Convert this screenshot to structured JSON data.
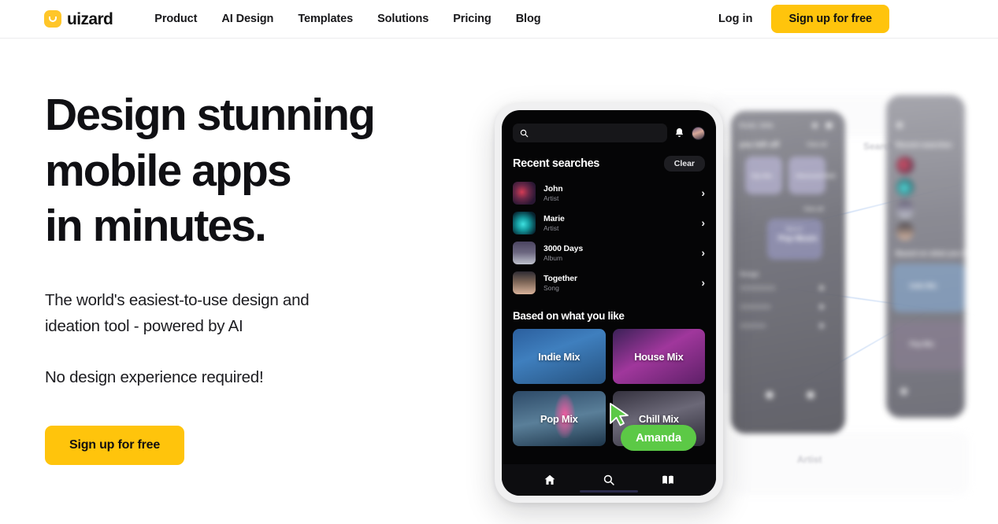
{
  "brand": {
    "name": "uizard",
    "logo_color": "#FFC629"
  },
  "nav": {
    "links": [
      {
        "label": "Product"
      },
      {
        "label": "AI Design"
      },
      {
        "label": "Templates"
      },
      {
        "label": "Solutions"
      },
      {
        "label": "Pricing"
      },
      {
        "label": "Blog"
      }
    ],
    "login_label": "Log in",
    "signup_label": "Sign up for free",
    "accent_color": "#FFC40C"
  },
  "hero": {
    "headline_line1": "Design stunning",
    "headline_line2": "mobile apps",
    "headline_line3": "in minutes.",
    "subtitle_line1": "The world's easiest-to-use design and",
    "subtitle_line2": "ideation tool - powered by AI",
    "note": "No design experience required!",
    "cta_label": "Sign up for free"
  },
  "phone": {
    "search": {
      "value": "",
      "placeholder": ""
    },
    "icons": {
      "search": "search-icon",
      "bell": "bell-icon",
      "avatar": "avatar"
    },
    "recent": {
      "title": "Recent searches",
      "clear_label": "Clear",
      "items": [
        {
          "name": "John",
          "type": "Artist"
        },
        {
          "name": "Marie",
          "type": "Artist"
        },
        {
          "name": "3000 Days",
          "type": "Album"
        },
        {
          "name": "Together",
          "type": "Song"
        }
      ]
    },
    "recommendations": {
      "title": "Based on what you like",
      "cards": [
        {
          "label": "Indie Mix"
        },
        {
          "label": "House Mix"
        },
        {
          "label": "Pop Mix"
        },
        {
          "label": "Chill Mix"
        }
      ]
    },
    "tabbar": [
      {
        "icon": "home-icon"
      },
      {
        "icon": "search-icon"
      },
      {
        "icon": "book-icon"
      }
    ]
  },
  "collaborator": {
    "name": "Amanda",
    "cursor_color": "#5CC946"
  },
  "background_screens": {
    "left": {
      "header": "Good, Julia",
      "section1": "you left off",
      "view_all": "View all",
      "chips": [
        "Hip Hits",
        "Obsessed R&B"
      ],
      "view_all2": "View all",
      "feature_card_small": "Best of",
      "feature_card": "Pop Music",
      "songs_label": "Songs"
    },
    "right": {
      "recent": "Recent searches",
      "based": "Based on what you like",
      "card1": "Indie Mix",
      "card2": "Pop Mix"
    },
    "floating_labels": [
      "Search",
      "Artist"
    ]
  }
}
